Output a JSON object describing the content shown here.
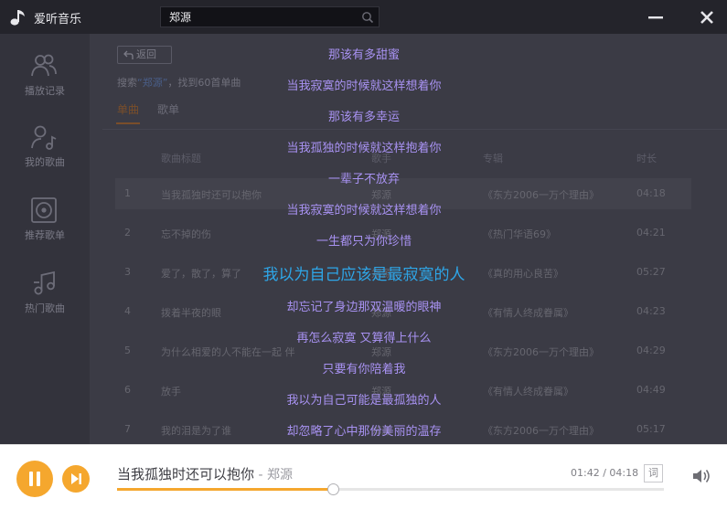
{
  "app": {
    "title": "爱听音乐",
    "search_value": "郑源",
    "colors": {
      "accent": "#f5a72e",
      "lyric": "#a892f2",
      "lyric_current": "#2ea6e8"
    }
  },
  "sidebar": {
    "items": [
      {
        "label": "播放记录",
        "icon": "users-icon"
      },
      {
        "label": "我的歌曲",
        "icon": "user-music-icon"
      },
      {
        "label": "推荐歌单",
        "icon": "disc-icon"
      },
      {
        "label": "热门歌曲",
        "icon": "music-notes-icon"
      }
    ]
  },
  "main": {
    "back_label": "返回",
    "result_prefix": "搜索",
    "keyword": "“郑源”",
    "result_suffix": "，找到60首单曲",
    "tabs": [
      {
        "label": "单曲"
      },
      {
        "label": "歌单"
      }
    ],
    "columns": [
      "歌曲标题",
      "歌手",
      "专辑",
      "时长"
    ],
    "rows": [
      {
        "num": "1",
        "title": "当我孤独时还可以抱你",
        "artist": "郑源",
        "album": "《东方2006一万个理由》",
        "duration": "04:18"
      },
      {
        "num": "2",
        "title": "忘不掉的伤",
        "artist": "郑源",
        "album": "《热门华语69》",
        "duration": "04:21"
      },
      {
        "num": "3",
        "title": "爱了，散了，算了",
        "artist": "郑源",
        "album": "《真的用心良苦》",
        "duration": "05:27"
      },
      {
        "num": "4",
        "title": "拨着半夜的眼",
        "artist": "郑源",
        "album": "《有情人终成眷属》",
        "duration": "04:23"
      },
      {
        "num": "5",
        "title": "为什么相爱的人不能在一起 伴",
        "artist": "郑源",
        "album": "《东方2006一万个理由》",
        "duration": "04:29"
      },
      {
        "num": "6",
        "title": "放手",
        "artist": "郑源",
        "album": "《有情人终成眷属》",
        "duration": "04:49"
      },
      {
        "num": "7",
        "title": "我的泪是为了谁",
        "artist": "郑源",
        "album": "《东方2006一万个理由》",
        "duration": "05:17"
      }
    ]
  },
  "lyrics": {
    "current_index": 8,
    "lines": [
      "那该有多甜蜜",
      "当我寂寞的时候就这样想着你",
      "那该有多幸运",
      "当我孤独的时候就这样抱着你",
      "一辈子不放弃",
      "当我寂寞的时候就这样想着你",
      "一生都只为你珍惜",
      "我以为自己应该是最寂寞的人",
      "却忘记了身边那双温暖的眼神",
      "再怎么寂寞 又算得上什么",
      "只要有你陪着我",
      "我以为自己可能是最孤独的人",
      "却忽略了心中那份美丽的温存"
    ]
  },
  "player": {
    "title": "当我孤独时还可以抱你",
    "artist": " - 郑源",
    "time": "01:42 / 04:18",
    "lyric_toggle": "词",
    "progress": 0.394
  }
}
